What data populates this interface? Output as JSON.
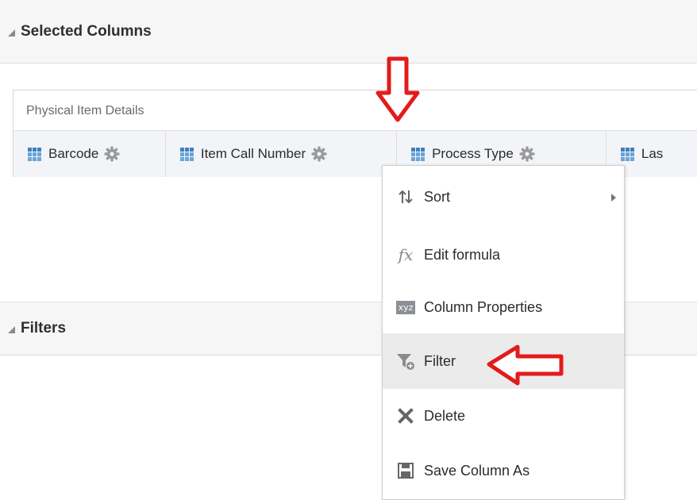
{
  "sections": {
    "selected_columns": {
      "title": "Selected Columns"
    },
    "filters": {
      "title": "Filters"
    }
  },
  "table": {
    "title": "Physical Item Details",
    "columns": [
      {
        "label": "Barcode"
      },
      {
        "label": "Item Call Number"
      },
      {
        "label": "Process Type"
      },
      {
        "label": "Las"
      }
    ]
  },
  "context_menu": {
    "items": [
      {
        "label": "Sort",
        "icon": "sort-icon",
        "has_submenu": true
      },
      {
        "label": "Edit formula",
        "icon": "fx-icon"
      },
      {
        "label": "Column Properties",
        "icon": "xyz-icon",
        "icon_text": "xyz"
      },
      {
        "label": "Filter",
        "icon": "filter-icon",
        "highlighted": true
      },
      {
        "label": "Delete",
        "icon": "delete-icon"
      },
      {
        "label": "Save Column As",
        "icon": "save-icon"
      }
    ]
  },
  "colors": {
    "annotation_arrow": "#e31b1b",
    "column_icon": "#4a8ccf",
    "gear": "#9a9a9a"
  }
}
